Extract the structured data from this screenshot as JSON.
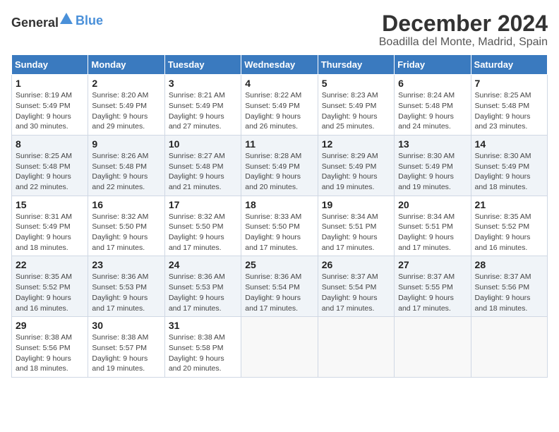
{
  "logo": {
    "text_general": "General",
    "text_blue": "Blue"
  },
  "title": "December 2024",
  "subtitle": "Boadilla del Monte, Madrid, Spain",
  "days_of_week": [
    "Sunday",
    "Monday",
    "Tuesday",
    "Wednesday",
    "Thursday",
    "Friday",
    "Saturday"
  ],
  "weeks": [
    [
      {
        "day": 1,
        "sunrise": "8:19 AM",
        "sunset": "5:49 PM",
        "daylight": "9 hours and 30 minutes."
      },
      {
        "day": 2,
        "sunrise": "8:20 AM",
        "sunset": "5:49 PM",
        "daylight": "9 hours and 29 minutes."
      },
      {
        "day": 3,
        "sunrise": "8:21 AM",
        "sunset": "5:49 PM",
        "daylight": "9 hours and 27 minutes."
      },
      {
        "day": 4,
        "sunrise": "8:22 AM",
        "sunset": "5:49 PM",
        "daylight": "9 hours and 26 minutes."
      },
      {
        "day": 5,
        "sunrise": "8:23 AM",
        "sunset": "5:49 PM",
        "daylight": "9 hours and 25 minutes."
      },
      {
        "day": 6,
        "sunrise": "8:24 AM",
        "sunset": "5:48 PM",
        "daylight": "9 hours and 24 minutes."
      },
      {
        "day": 7,
        "sunrise": "8:25 AM",
        "sunset": "5:48 PM",
        "daylight": "9 hours and 23 minutes."
      }
    ],
    [
      {
        "day": 8,
        "sunrise": "8:25 AM",
        "sunset": "5:48 PM",
        "daylight": "9 hours and 22 minutes."
      },
      {
        "day": 9,
        "sunrise": "8:26 AM",
        "sunset": "5:48 PM",
        "daylight": "9 hours and 22 minutes."
      },
      {
        "day": 10,
        "sunrise": "8:27 AM",
        "sunset": "5:48 PM",
        "daylight": "9 hours and 21 minutes."
      },
      {
        "day": 11,
        "sunrise": "8:28 AM",
        "sunset": "5:49 PM",
        "daylight": "9 hours and 20 minutes."
      },
      {
        "day": 12,
        "sunrise": "8:29 AM",
        "sunset": "5:49 PM",
        "daylight": "9 hours and 19 minutes."
      },
      {
        "day": 13,
        "sunrise": "8:30 AM",
        "sunset": "5:49 PM",
        "daylight": "9 hours and 19 minutes."
      },
      {
        "day": 14,
        "sunrise": "8:30 AM",
        "sunset": "5:49 PM",
        "daylight": "9 hours and 18 minutes."
      }
    ],
    [
      {
        "day": 15,
        "sunrise": "8:31 AM",
        "sunset": "5:49 PM",
        "daylight": "9 hours and 18 minutes."
      },
      {
        "day": 16,
        "sunrise": "8:32 AM",
        "sunset": "5:50 PM",
        "daylight": "9 hours and 17 minutes."
      },
      {
        "day": 17,
        "sunrise": "8:32 AM",
        "sunset": "5:50 PM",
        "daylight": "9 hours and 17 minutes."
      },
      {
        "day": 18,
        "sunrise": "8:33 AM",
        "sunset": "5:50 PM",
        "daylight": "9 hours and 17 minutes."
      },
      {
        "day": 19,
        "sunrise": "8:34 AM",
        "sunset": "5:51 PM",
        "daylight": "9 hours and 17 minutes."
      },
      {
        "day": 20,
        "sunrise": "8:34 AM",
        "sunset": "5:51 PM",
        "daylight": "9 hours and 17 minutes."
      },
      {
        "day": 21,
        "sunrise": "8:35 AM",
        "sunset": "5:52 PM",
        "daylight": "9 hours and 16 minutes."
      }
    ],
    [
      {
        "day": 22,
        "sunrise": "8:35 AM",
        "sunset": "5:52 PM",
        "daylight": "9 hours and 16 minutes."
      },
      {
        "day": 23,
        "sunrise": "8:36 AM",
        "sunset": "5:53 PM",
        "daylight": "9 hours and 17 minutes."
      },
      {
        "day": 24,
        "sunrise": "8:36 AM",
        "sunset": "5:53 PM",
        "daylight": "9 hours and 17 minutes."
      },
      {
        "day": 25,
        "sunrise": "8:36 AM",
        "sunset": "5:54 PM",
        "daylight": "9 hours and 17 minutes."
      },
      {
        "day": 26,
        "sunrise": "8:37 AM",
        "sunset": "5:54 PM",
        "daylight": "9 hours and 17 minutes."
      },
      {
        "day": 27,
        "sunrise": "8:37 AM",
        "sunset": "5:55 PM",
        "daylight": "9 hours and 17 minutes."
      },
      {
        "day": 28,
        "sunrise": "8:37 AM",
        "sunset": "5:56 PM",
        "daylight": "9 hours and 18 minutes."
      }
    ],
    [
      {
        "day": 29,
        "sunrise": "8:38 AM",
        "sunset": "5:56 PM",
        "daylight": "9 hours and 18 minutes."
      },
      {
        "day": 30,
        "sunrise": "8:38 AM",
        "sunset": "5:57 PM",
        "daylight": "9 hours and 19 minutes."
      },
      {
        "day": 31,
        "sunrise": "8:38 AM",
        "sunset": "5:58 PM",
        "daylight": "9 hours and 20 minutes."
      },
      null,
      null,
      null,
      null
    ]
  ]
}
